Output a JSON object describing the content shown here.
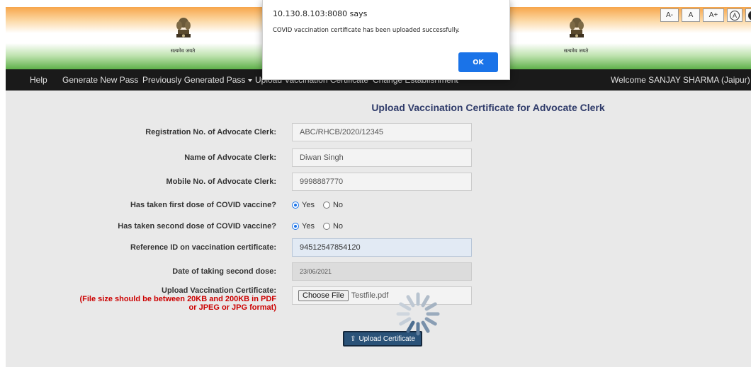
{
  "header": {
    "emblem_motto": "सत्यमेव जयते",
    "font_controls": [
      "A-",
      "A",
      "A+",
      "A",
      "A"
    ]
  },
  "navbar": {
    "help": "Help",
    "generate_new_pass": "Generate New Pass",
    "previously_generated_pass": "Previously Generated Pass",
    "upload_vaccination_certificate": "Upload Vaccination Certificate",
    "change_establishment": "Change Establishment",
    "welcome": "Welcome SANJAY SHARMA (Jaipur)"
  },
  "form": {
    "title": "Upload Vaccination Certificate for Advocate Clerk",
    "registration_label": "Registration No. of Advocate Clerk:",
    "registration_value": "ABC/RHCB/2020/12345",
    "name_label": "Name of Advocate Clerk:",
    "name_value": "Diwan Singh",
    "mobile_label": "Mobile No. of Advocate Clerk:",
    "mobile_value": "9998887770",
    "first_dose_label": "Has taken first dose of COVID vaccine?",
    "second_dose_label": "Has taken second dose of COVID vaccine?",
    "yes": "Yes",
    "no": "No",
    "first_dose_selected": "Yes",
    "second_dose_selected": "Yes",
    "reference_label": "Reference ID on vaccination certificate:",
    "reference_value": "94512547854120",
    "date_label": "Date of taking second dose:",
    "date_value": "23/06/2021",
    "upload_label": "Upload Vaccination Certificate:",
    "upload_hint_1": "(File size should be between 20KB and 200KB in PDF",
    "upload_hint_2": "or JPEG or JPG format)",
    "choose_file": "Choose File",
    "file_name": "Testfile.pdf",
    "upload_button": "Upload Certificate"
  },
  "dialog": {
    "origin": "10.130.8.103:8080 says",
    "message": "COVID vaccination certificate has been uploaded successfully.",
    "ok": "OK"
  },
  "colors": {
    "accent": "#1a73e8",
    "title": "#2f3b6a",
    "hint_red": "#cc0000",
    "button": "#2a5278"
  }
}
